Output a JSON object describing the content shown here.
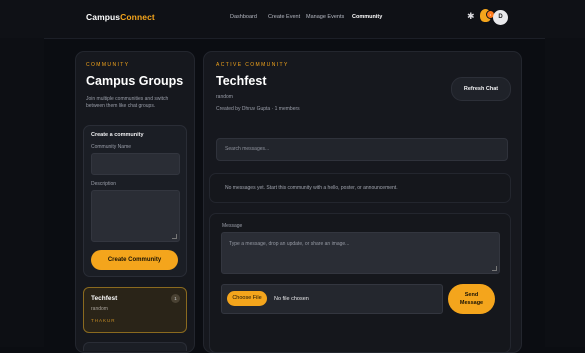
{
  "brand": {
    "part1": "Campus",
    "part2": "Connect"
  },
  "nav": {
    "items": [
      "Dashboard",
      "Create Event",
      "Manage Events",
      "Community"
    ],
    "active": "Community"
  },
  "header_icons": {
    "theme": "sun-icon",
    "notification": "bulb-icon",
    "avatar_initial": "D"
  },
  "sidebar": {
    "eyebrow": "COMMUNITY",
    "title": "Campus Groups",
    "description": "Join multiple communities and switch between them like chat groups.",
    "create": {
      "heading": "Create a community",
      "name_label": "Community Name",
      "name_value": "",
      "desc_label": "Description",
      "desc_value": "",
      "button": "Create Community"
    },
    "communities": [
      {
        "name": "Techfest",
        "description": "random",
        "owner": "THAKUR",
        "badge": "1"
      }
    ]
  },
  "main": {
    "eyebrow": "ACTIVE COMMUNITY",
    "title": "Techfest",
    "subtitle": "random",
    "meta": "Created by Dhruv Gupta · 1 members",
    "refresh_button": "Refresh Chat",
    "search_placeholder": "Search messages...",
    "empty_message": "No messages yet. Start this community with a hello, poster, or announcement.",
    "message_label": "Message",
    "message_placeholder": "Type a message, drop an update, or share an image...",
    "file_button": "Choose File",
    "file_status": "No file chosen",
    "send_button_line1": "Send",
    "send_button_line2": "Message"
  },
  "colors": {
    "accent": "#f4a51c",
    "background": "#0b0d12",
    "panel": "#16181e"
  }
}
